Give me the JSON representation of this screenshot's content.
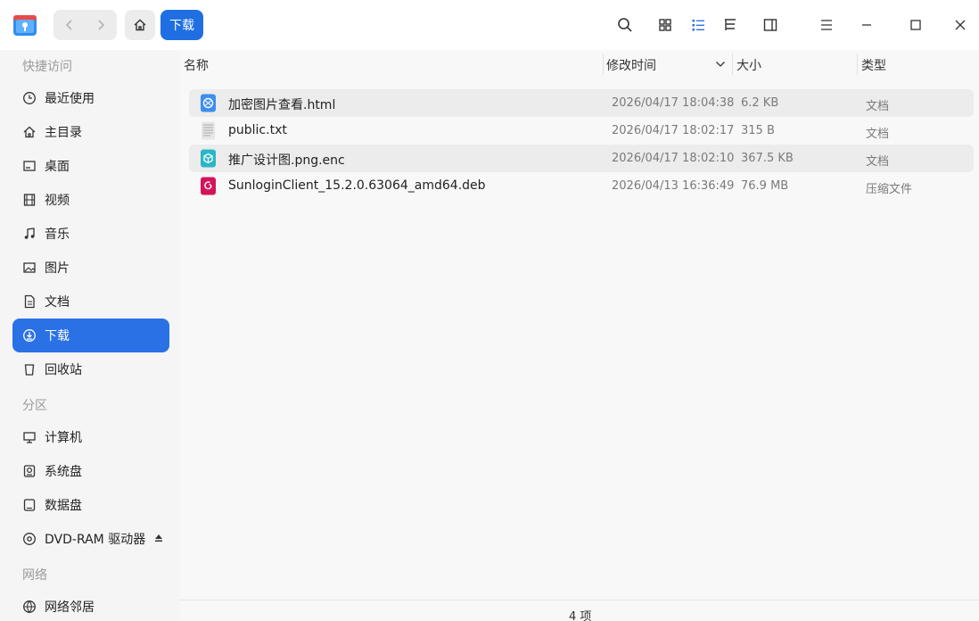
{
  "toolbar": {
    "breadcrumb": "下载"
  },
  "sidebar": {
    "sections": {
      "quick": "快捷访问",
      "partitions": "分区",
      "network": "网络"
    },
    "quick_items": [
      {
        "label": "最近使用",
        "icon": "clock-icon"
      },
      {
        "label": "主目录",
        "icon": "home-icon"
      },
      {
        "label": "桌面",
        "icon": "desktop-icon"
      },
      {
        "label": "视频",
        "icon": "film-icon"
      },
      {
        "label": "音乐",
        "icon": "music-icon"
      },
      {
        "label": "图片",
        "icon": "image-icon"
      },
      {
        "label": "文档",
        "icon": "document-icon"
      },
      {
        "label": "下载",
        "icon": "download-icon",
        "active": true
      },
      {
        "label": "回收站",
        "icon": "trash-icon"
      }
    ],
    "partition_items": [
      {
        "label": "计算机",
        "icon": "computer-icon"
      },
      {
        "label": "系统盘",
        "icon": "disk-icon"
      },
      {
        "label": "数据盘",
        "icon": "drive-icon"
      },
      {
        "label": "DVD-RAM 驱动器",
        "icon": "disc-icon"
      }
    ],
    "network_items": [
      {
        "label": "网络邻居",
        "icon": "network-icon"
      }
    ]
  },
  "columns": {
    "name": "名称",
    "modified": "修改时间",
    "size": "大小",
    "type": "类型"
  },
  "files": [
    {
      "name": "加密图片查看.html",
      "modified": "2026/04/17 18:04:38",
      "size": "6.2 KB",
      "type": "文档",
      "icon": "html-file-icon"
    },
    {
      "name": "public.txt",
      "modified": "2026/04/17 18:02:17",
      "size": "315 B",
      "type": "文档",
      "icon": "text-file-icon"
    },
    {
      "name": "推广设计图.png.enc",
      "modified": "2026/04/17 18:02:10",
      "size": "367.5 KB",
      "type": "文档",
      "icon": "encrypted-file-icon"
    },
    {
      "name": "SunloginClient_15.2.0.63064_amd64.deb",
      "modified": "2026/04/13 16:36:49",
      "size": "76.9 MB",
      "type": "压缩文件",
      "icon": "deb-package-icon"
    }
  ],
  "status": {
    "count": "4 项"
  },
  "colors": {
    "accent": "#2a71e6",
    "breadcrumb": "#1f6fe3"
  }
}
